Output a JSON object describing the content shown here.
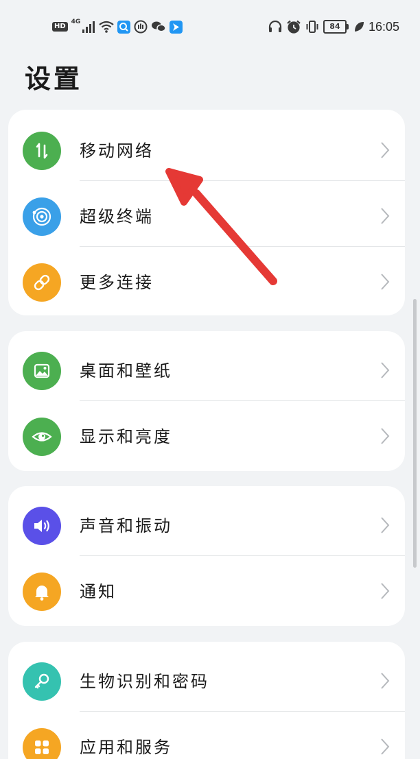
{
  "status_bar": {
    "hd_badge": "HD",
    "network": "4G",
    "time": "16:05",
    "battery": "84"
  },
  "header": {
    "title": "设置"
  },
  "groups": [
    {
      "items": [
        {
          "label": "移动网络",
          "icon": "mobile-network-icon",
          "color": "#4caf50"
        },
        {
          "label": "超级终端",
          "icon": "super-device-icon",
          "color": "#3aa0e8"
        },
        {
          "label": "更多连接",
          "icon": "more-connections-icon",
          "color": "#f5a623"
        }
      ]
    },
    {
      "items": [
        {
          "label": "桌面和壁纸",
          "icon": "wallpaper-icon",
          "color": "#4caf50"
        },
        {
          "label": "显示和亮度",
          "icon": "display-brightness-icon",
          "color": "#4caf50"
        }
      ]
    },
    {
      "items": [
        {
          "label": "声音和振动",
          "icon": "sound-vibration-icon",
          "color": "#5a50e8"
        },
        {
          "label": "通知",
          "icon": "notification-bell-icon",
          "color": "#f5a623"
        }
      ]
    },
    {
      "items": [
        {
          "label": "生物识别和密码",
          "icon": "biometrics-key-icon",
          "color": "#35c2b0"
        },
        {
          "label": "应用和服务",
          "icon": "apps-services-icon",
          "color": "#f5a623"
        }
      ]
    }
  ],
  "colors": {
    "background": "#f1f3f5",
    "card": "#ffffff",
    "annotation_arrow": "#e53935"
  }
}
